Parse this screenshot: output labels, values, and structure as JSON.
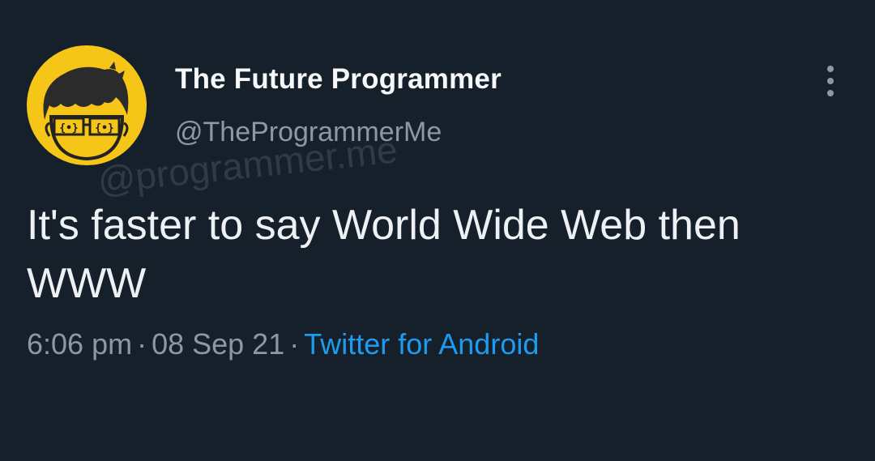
{
  "tweet": {
    "author": {
      "display_name": "The Future Programmer",
      "handle": "@TheProgrammerMe",
      "avatar_icon": "programmer-avatar-icon",
      "avatar_bg": "#f5c518"
    },
    "text": "It's faster to say World Wide Web then WWW",
    "watermark": "@programmer.me",
    "meta": {
      "time": "6:06 pm",
      "separator": "·",
      "date": "08 Sep 21",
      "source": "Twitter for Android"
    },
    "more_icon": "more-vertical-icon"
  },
  "colors": {
    "background": "#15202b",
    "text": "#eef1f3",
    "muted": "#8b98a5",
    "link": "#1d9bf0"
  }
}
